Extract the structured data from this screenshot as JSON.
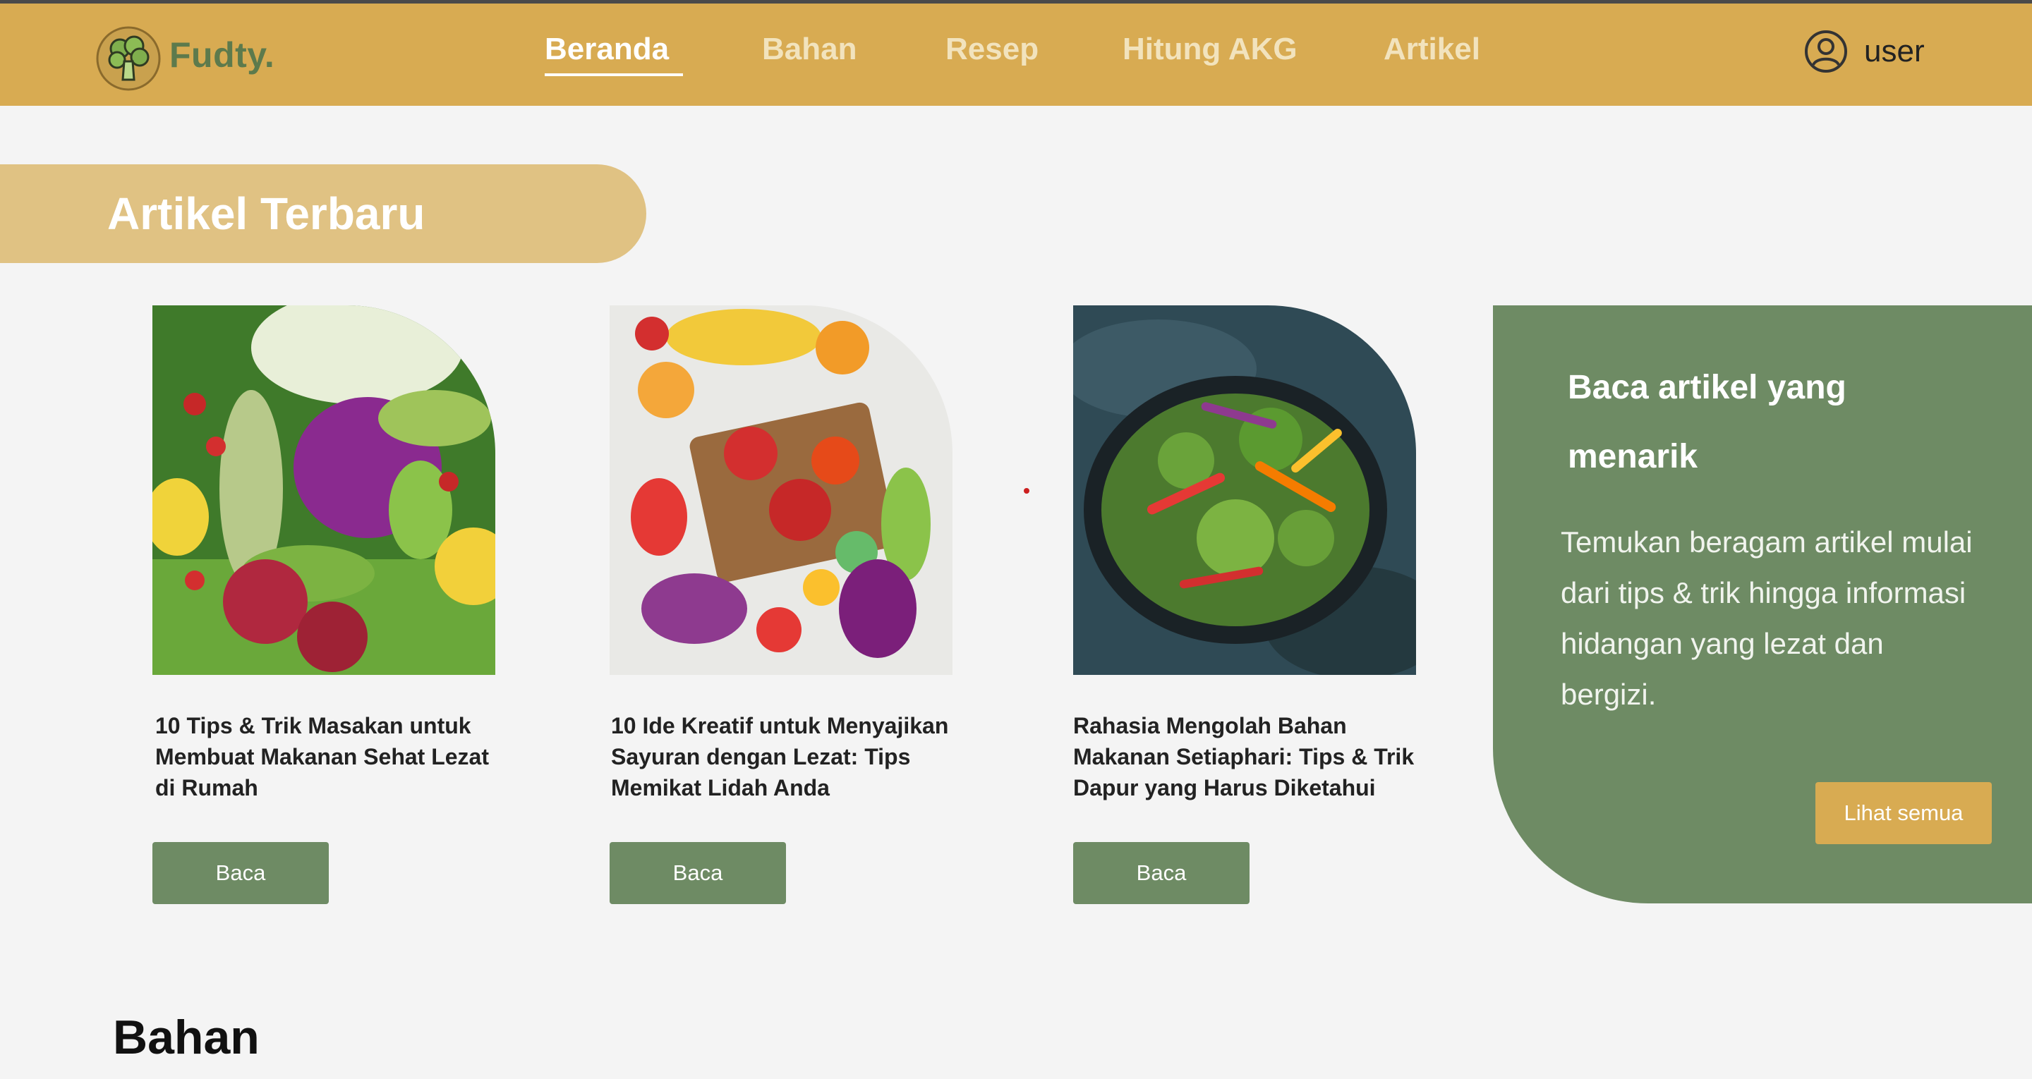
{
  "brand": {
    "name": "Fudty."
  },
  "nav": {
    "items": [
      {
        "label": "Beranda",
        "active": true
      },
      {
        "label": "Bahan",
        "active": false
      },
      {
        "label": "Resep",
        "active": false
      },
      {
        "label": "Hitung AKG",
        "active": false
      },
      {
        "label": "Artikel",
        "active": false
      }
    ],
    "user": {
      "name": "user",
      "icon": "user-circle-icon"
    }
  },
  "section_banner": {
    "title": "Artikel Terbaru"
  },
  "articles": [
    {
      "image": "vegetables-assortment-photo",
      "title": "10 Tips & Trik Masakan untuk Membuat Makanan Sehat Lezat di Rumah",
      "button_label": "Baca"
    },
    {
      "image": "fruits-and-vegetables-cutting-board-photo",
      "title": "10 Ide Kreatif untuk Menyajikan Sayuran dengan Lezat: Tips Memikat Lidah Anda",
      "button_label": "Baca"
    },
    {
      "image": "salad-plate-photo",
      "title": "Rahasia Mengolah Bahan Makanan Setiaphari: Tips & Trik Dapur yang Harus Diketahui",
      "button_label": "Baca"
    }
  ],
  "promo": {
    "title": "Baca artikel yang menarik",
    "description": "Temukan beragam artikel mulai dari tips & trik hingga informasi  hidangan yang lezat dan bergizi.",
    "button_label": "Lihat semua"
  },
  "next_section": {
    "title": "Bahan"
  },
  "colors": {
    "navbar": "#d8ab52",
    "banner": "#e0c283",
    "primary_green": "#6e8b64",
    "accent_gold": "#d8ab52",
    "background": "#f4f4f4"
  }
}
